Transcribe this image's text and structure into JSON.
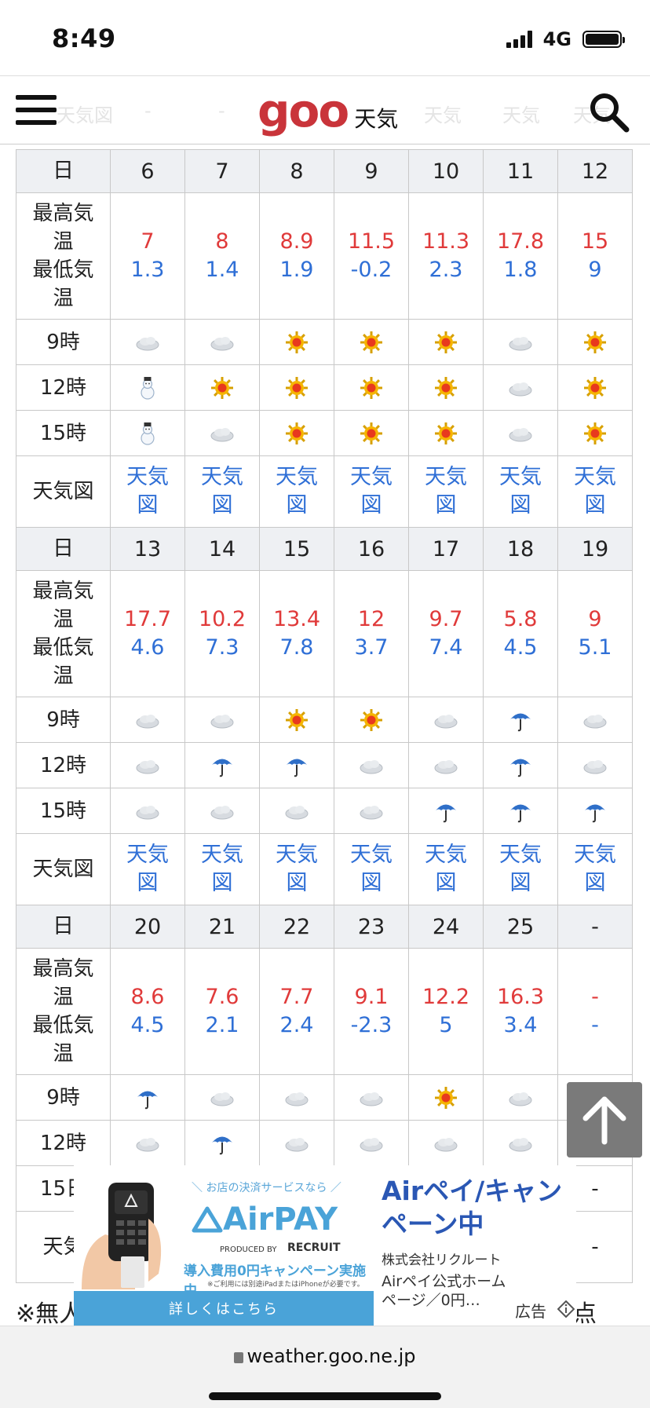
{
  "status_bar": {
    "time": "8:49",
    "network": "4G"
  },
  "header": {
    "logo": "goo",
    "logo_sub": "天気",
    "ghost_text": [
      "天気図",
      "-",
      "-",
      "天気",
      "天気",
      "天気",
      "天気"
    ]
  },
  "labels": {
    "day": "日",
    "hi_1": "最高気",
    "hi_2": "温",
    "lo_1": "最低気",
    "lo_2": "温",
    "h9": "9時",
    "h12": "12時",
    "h15": "15時",
    "map": "天気図",
    "map_1": "天気",
    "map_2": "図"
  },
  "weeks": [
    {
      "days": [
        "6",
        "7",
        "8",
        "9",
        "10",
        "11",
        "12"
      ],
      "highs": [
        "7",
        "8",
        "8.9",
        "11.5",
        "11.3",
        "17.8",
        "15"
      ],
      "lows": [
        "1.3",
        "1.4",
        "1.9",
        "-0.2",
        "2.3",
        "1.8",
        "9"
      ],
      "h9": [
        "cloud",
        "cloud",
        "sun",
        "sun",
        "sun",
        "cloud",
        "sun"
      ],
      "h12": [
        "snow",
        "sun",
        "sun",
        "sun",
        "sun",
        "cloud",
        "sun"
      ],
      "h15": [
        "snow",
        "cloud",
        "sun",
        "sun",
        "sun",
        "cloud",
        "sun"
      ]
    },
    {
      "days": [
        "13",
        "14",
        "15",
        "16",
        "17",
        "18",
        "19"
      ],
      "highs": [
        "17.7",
        "10.2",
        "13.4",
        "12",
        "9.7",
        "5.8",
        "9"
      ],
      "lows": [
        "4.6",
        "7.3",
        "7.8",
        "3.7",
        "7.4",
        "4.5",
        "5.1"
      ],
      "h9": [
        "cloud",
        "cloud",
        "sun",
        "sun",
        "cloud",
        "rain",
        "cloud"
      ],
      "h12": [
        "cloud",
        "rain",
        "rain",
        "cloud",
        "cloud",
        "rain",
        "cloud"
      ],
      "h15": [
        "cloud",
        "cloud",
        "cloud",
        "cloud",
        "rain",
        "rain",
        "rain"
      ]
    },
    {
      "days": [
        "20",
        "21",
        "22",
        "23",
        "24",
        "25",
        "-"
      ],
      "highs": [
        "8.6",
        "7.6",
        "7.7",
        "9.1",
        "12.2",
        "16.3",
        "-"
      ],
      "lows": [
        "4.5",
        "2.1",
        "2.4",
        "-2.3",
        "5",
        "3.4",
        "-"
      ],
      "h9": [
        "rain",
        "cloud",
        "cloud",
        "cloud",
        "sun",
        "cloud",
        "-"
      ],
      "h12": [
        "cloud",
        "rain",
        "cloud",
        "cloud",
        "cloud",
        "cloud",
        "-"
      ],
      "h15_visible_label": "15日",
      "h15_last": "-",
      "map_visible_label": "天気",
      "map_last": "-"
    }
  ],
  "ad": {
    "tag": "＼ お店の決済サービスなら ／",
    "brand": "AirPAY",
    "produced_by": "PRODUCED BY",
    "recruit": "RECRUIT",
    "campaign": "導入費用0円キャンペーン実施中",
    "fine_print": "※ご利用には別途iPadまたはiPhoneが必要です。",
    "cta": "詳しくはこちら",
    "title": "Airペイ/キャンペーン中",
    "company": "株式会社リクルート",
    "desc": "Airペイ公式ホームページ／0円…",
    "label": "広告"
  },
  "note": "※無人",
  "note_tail": "点",
  "url": "weather.goo.ne.jp",
  "icons": {
    "menu": "hamburger-menu-icon",
    "search": "search-icon",
    "scroll_top": "arrow-up-icon"
  }
}
